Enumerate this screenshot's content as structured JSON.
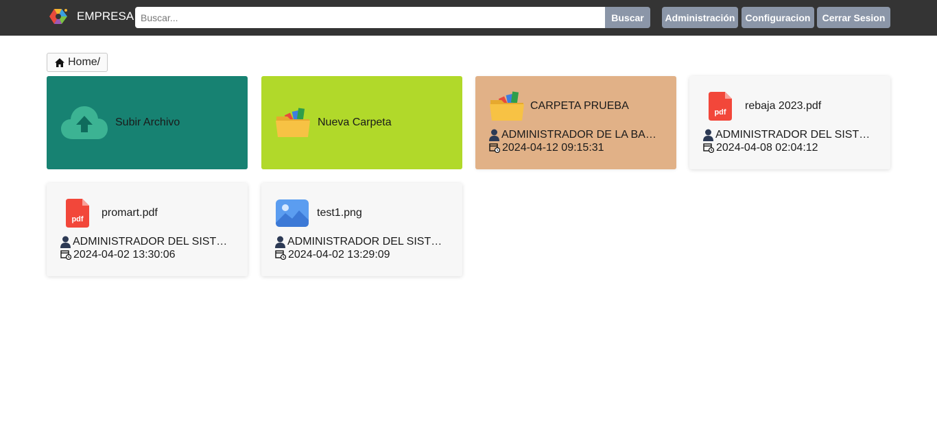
{
  "header": {
    "brand": "EMPRESA",
    "search_placeholder": "Buscar...",
    "search_button": "Buscar",
    "nav": [
      "Administración",
      "Configuracion",
      "Cerrar Sesion"
    ]
  },
  "breadcrumb": {
    "label": "Home/"
  },
  "actions": {
    "upload": "Subir Archivo",
    "new_folder": "Nueva Carpeta"
  },
  "items": [
    {
      "name": "CARPETA PRUEBA",
      "type": "folder-icon",
      "owner": "ADMINISTRADOR DE LA BASE DE DATOS",
      "date": "2024-04-12 09:15:31"
    },
    {
      "name": "rebaja 2023.pdf",
      "type": "pdf-icon",
      "owner": "ADMINISTRADOR DEL SISTEMA",
      "date": "2024-04-08 02:04:12"
    },
    {
      "name": "promart.pdf",
      "type": "pdf-icon",
      "owner": "ADMINISTRADOR DEL SISTEMA",
      "date": "2024-04-02 13:30:06"
    },
    {
      "name": "test1.png",
      "type": "image-icon",
      "owner": "ADMINISTRADOR DEL SISTEMA",
      "date": "2024-04-02 13:29:09"
    }
  ],
  "colors": {
    "navbar": "#343434",
    "button": "#8b96a8",
    "upload_card": "#178272",
    "new_folder_card": "#b1d92a",
    "folder_card": "#e1b187",
    "file_card": "#f7f7f7"
  }
}
